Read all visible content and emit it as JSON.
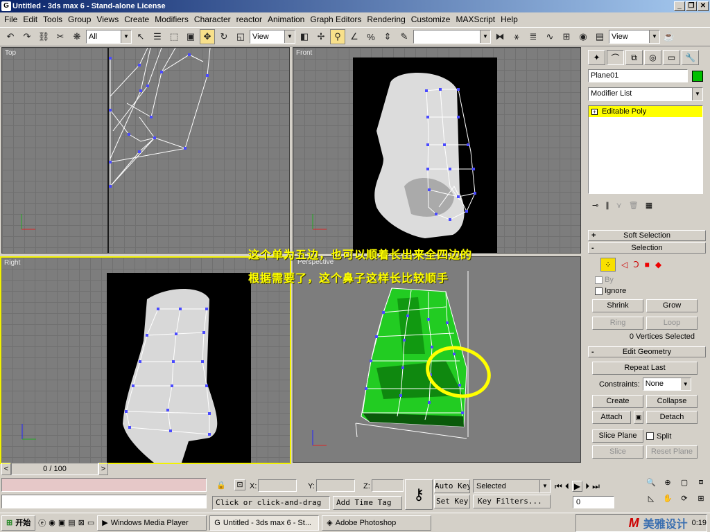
{
  "window": {
    "title": "Untitled - 3ds max 6 - Stand-alone License"
  },
  "menu": [
    "File",
    "Edit",
    "Tools",
    "Group",
    "Views",
    "Create",
    "Modifiers",
    "Character",
    "reactor",
    "Animation",
    "Graph Editors",
    "Rendering",
    "Customize",
    "MAXScript",
    "Help"
  ],
  "toolbar": {
    "filter_value": "All",
    "refcoord_value": "View",
    "selset_value": "",
    "view_value": "View"
  },
  "viewports": {
    "top": "Top",
    "front": "Front",
    "right": "Right",
    "perspective": "Perspective"
  },
  "overlay": {
    "line1": "这个单为五边，也可以顺着长出来全四边的",
    "line2": "根据需要了，这个鼻子这样长比较顺手"
  },
  "panel": {
    "object_name": "Plane01",
    "object_color": "#00c000",
    "modifier_list": "Modifier List",
    "stack_item": "Editable Poly",
    "soft_selection": "Soft Selection",
    "selection": "Selection",
    "by": "By",
    "ignore": "Ignore",
    "shrink": "Shrink",
    "grow": "Grow",
    "ring": "Ring",
    "loop": "Loop",
    "sel_status": "0 Vertices Selected",
    "edit_geometry": "Edit Geometry",
    "repeat_last": "Repeat Last",
    "constraints_label": "Constraints:",
    "constraints_value": "None",
    "create": "Create",
    "collapse": "Collapse",
    "attach": "Attach",
    "detach": "Detach",
    "slice_plane": "Slice Plane",
    "split": "Split",
    "slice": "Slice",
    "reset_plane": "Reset Plane"
  },
  "timeline": {
    "frame": "0 / 100"
  },
  "status": {
    "x_label": "X:",
    "y_label": "Y:",
    "z_label": "Z:",
    "prompt": "Click or click-and-drag",
    "add_time_tag": "Add Time Tag",
    "auto_key": "Auto Key",
    "set_key": "Set Key",
    "key_mode": "Selected",
    "key_filters": "Key Filters...",
    "frame_field": "0"
  },
  "taskbar": {
    "start": "开始",
    "tasks": [
      "Windows Media Player",
      "Untitled - 3ds max 6 - St...",
      "Adobe Photoshop"
    ],
    "clock": "0:19",
    "watermark": "美雅设计"
  },
  "colors": {
    "highlight_yellow": "#ffff00",
    "mesh_green": "#22cc22",
    "title_blue": "#0a246a"
  }
}
